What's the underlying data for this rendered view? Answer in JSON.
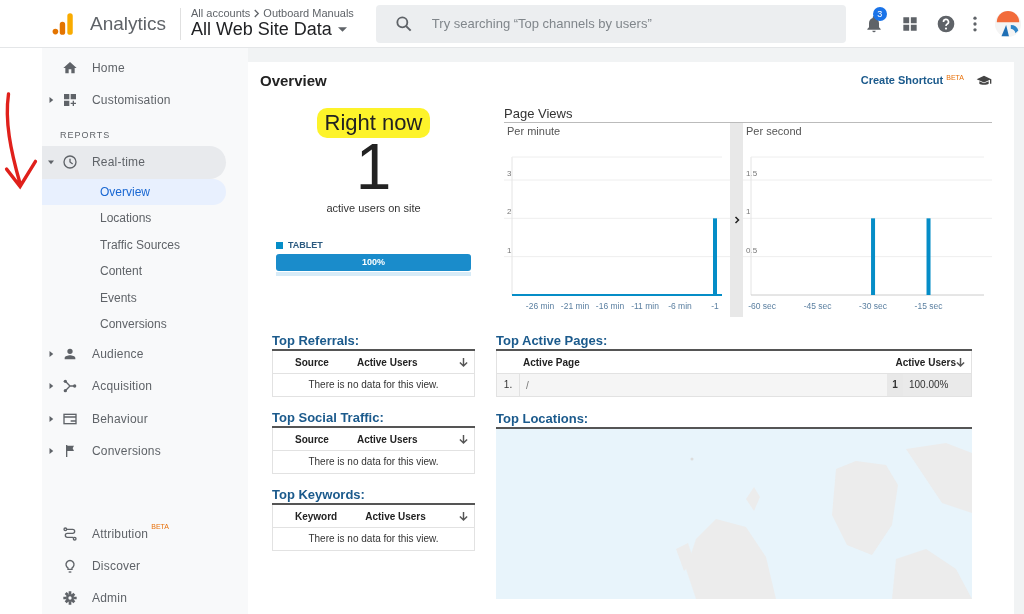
{
  "header": {
    "product": "Analytics",
    "breadcrumb": [
      "All accounts",
      "Outboard Manuals"
    ],
    "view": "All Web Site Data",
    "search": {
      "placeholder": "Try searching “Top channels by users”"
    },
    "notification_count": "3"
  },
  "sidebar": {
    "top_items": [
      {
        "label": "Home",
        "selected": false
      },
      {
        "label": "Customisation",
        "selected": false,
        "expanded": false
      }
    ],
    "section_heading": "REPORTS",
    "report_items": [
      {
        "label": "Real-time",
        "selected": false,
        "expanded": true,
        "children": [
          {
            "label": "Overview",
            "selected": true
          },
          {
            "label": "Locations",
            "selected": false
          },
          {
            "label": "Traffic Sources",
            "selected": false
          },
          {
            "label": "Content",
            "selected": false
          },
          {
            "label": "Events",
            "selected": false
          },
          {
            "label": "Conversions",
            "selected": false
          }
        ]
      },
      {
        "label": "Audience",
        "selected": false,
        "expanded": false
      },
      {
        "label": "Acquisition",
        "selected": false,
        "expanded": false
      },
      {
        "label": "Behaviour",
        "selected": false,
        "expanded": false
      },
      {
        "label": "Conversions",
        "selected": false,
        "expanded": false
      }
    ],
    "bottom_items": [
      {
        "label": "Attribution",
        "badge": "BETA",
        "selected": false
      },
      {
        "label": "Discover",
        "selected": false
      },
      {
        "label": "Admin",
        "selected": false
      }
    ]
  },
  "main": {
    "title": "Overview",
    "shortcut": {
      "label": "Create Shortcut",
      "badge": "BETA"
    },
    "right_now": {
      "label": "Right now",
      "highlighted": true,
      "count": "1",
      "caption": "active users on site",
      "devices": [
        {
          "label": "TABLET",
          "level": 1,
          "reading": "100%"
        }
      ]
    },
    "page_views": {
      "title": "Page Views",
      "panels": [
        {
          "chart_data": {
            "type": "bar",
            "title": "Per minute",
            "x": [
              -1
            ],
            "values": [
              2
            ],
            "xlim": [
              -30,
              0
            ],
            "ylim": [
              0,
              3.6
            ],
            "grid": true,
            "yticks": [
              1,
              2,
              3
            ],
            "xticks": [
              {
                "value": -26,
                "label": "-26 min"
              },
              {
                "value": -21,
                "label": "-21 min"
              },
              {
                "value": -16,
                "label": "-16 min"
              },
              {
                "value": -11,
                "label": "-11 min"
              },
              {
                "value": -6,
                "label": "-6 min"
              },
              {
                "value": -1,
                "label": "-1"
              }
            ]
          }
        },
        {
          "chart_data": {
            "type": "bar",
            "title": "Per second",
            "x": [
              -30,
              -15
            ],
            "values": [
              1,
              1
            ],
            "xlim": [
              -63,
              0
            ],
            "ylim": [
              0,
              1.8
            ],
            "grid": true,
            "yticks": [
              0.5,
              1,
              1.5
            ],
            "xticks": [
              {
                "value": -60,
                "label": "-60 sec"
              },
              {
                "value": -45,
                "label": "-45 sec"
              },
              {
                "value": -30,
                "label": "-30 sec"
              },
              {
                "value": -15,
                "label": "-15 sec"
              }
            ]
          }
        }
      ]
    },
    "small_tables": [
      {
        "title": "Top Referrals:",
        "columns": [
          {
            "label": "Source",
            "sorted": false
          },
          {
            "label": "Active Users",
            "sorted": true
          }
        ],
        "empty_message": "There is no data for this view."
      },
      {
        "title": "Top Social Traffic:",
        "columns": [
          {
            "label": "Source",
            "sorted": false
          },
          {
            "label": "Active Users",
            "sorted": true
          }
        ],
        "empty_message": "There is no data for this view."
      },
      {
        "title": "Top Keywords:",
        "columns": [
          {
            "label": "Keyword",
            "sorted": false
          },
          {
            "label": "Active Users",
            "sorted": true
          }
        ],
        "empty_message": "There is no data for this view."
      }
    ],
    "active_pages": {
      "title": "Top Active Pages:",
      "columns": [
        {
          "label": "Active Page",
          "sorted": false
        },
        {
          "label": "Active Users",
          "sorted": true
        }
      ],
      "rows": [
        {
          "rank": "1.",
          "page": "/",
          "users": "1",
          "share": "100.00%"
        }
      ]
    },
    "locations": {
      "title": "Top Locations:"
    }
  }
}
